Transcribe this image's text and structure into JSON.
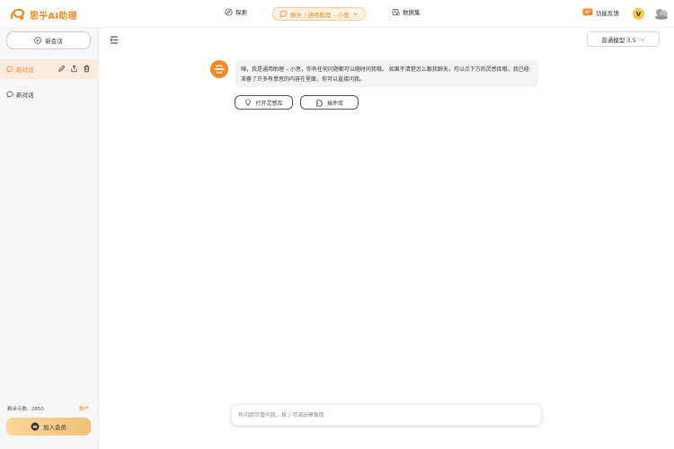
{
  "app": {
    "name": "思乎AI助理"
  },
  "nav": {
    "explore": "探索",
    "chat": "聊天 / 通用助理 – 小思",
    "data": "数据集"
  },
  "header": {
    "feedback": "功能反馈",
    "vip_badge": "V"
  },
  "sidebar": {
    "new_chat": "新会话",
    "chats": [
      {
        "label": "新对话",
        "active": true
      },
      {
        "label": "新对话",
        "active": false
      }
    ],
    "points_label": "剩余点数:",
    "points_value": "2850",
    "recharge": "账户",
    "join_member": "加入会员"
  },
  "main": {
    "model": "普通模型 3.5",
    "message": "嗨，我是通用助理 – 小思，你有任何问题都可以随时问我哦。 如果不清楚怎么跟我聊天，可以点下方的灵感库哦，我已经准备了许多有意思的内容在里面，你可以直接问我。",
    "library_button": "打开灵感库",
    "plugin_button": "插件库",
    "input_placeholder": "有问题尽管问我，按 / 可调出模板库"
  },
  "colors": {
    "accent": "#f08a24",
    "accent_light": "#fdeadd",
    "gold": "#f3c177"
  }
}
